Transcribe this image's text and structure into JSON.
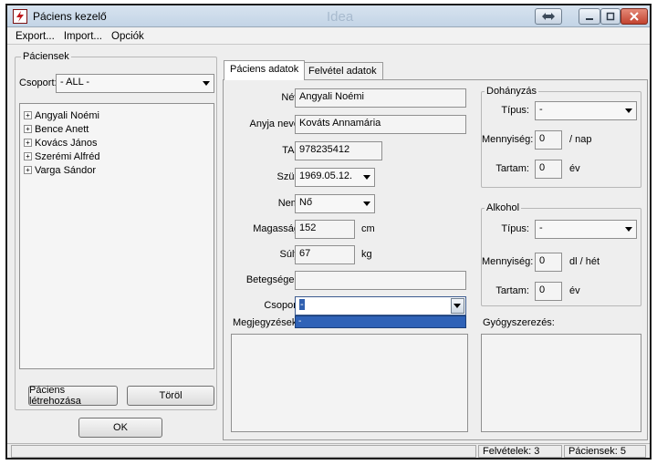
{
  "window": {
    "title": "Páciens kezelő",
    "watermark": "Idea"
  },
  "menu": [
    "Export...",
    "Import...",
    "Opciók"
  ],
  "left": {
    "group_title": "Páciensek",
    "group_filter_label": "Csoport:",
    "group_filter_value": "- ALL -",
    "patients": [
      "Angyali Noémi",
      "Bence Anett",
      "Kovács János",
      "Szerémi Alfréd",
      "Varga Sándor"
    ],
    "create_button": "Páciens létrehozása",
    "delete_button": "Töröl",
    "ok_button": "OK"
  },
  "tabs": [
    "Páciens adatok",
    "Felvétel adatok"
  ],
  "form": {
    "name_label": "Név:",
    "name_value": "Angyali Noémi",
    "mother_label": "Anyja neve:",
    "mother_value": "Kováts Annamária",
    "taj_label": "TAJ:",
    "taj_value": "978235412",
    "birth_label": "Szül.:",
    "birth_value": "1969.05.12.",
    "sex_label": "Nem:",
    "sex_value": "Nő",
    "height_label": "Magasság:",
    "height_value": "152",
    "height_unit": "cm",
    "weight_label": "Súly:",
    "weight_value": "67",
    "weight_unit": "kg",
    "disease_label": "Betegségek:",
    "disease_value": "",
    "group_label": "Csoport:",
    "group_value": "-",
    "group_dropdown_option": "-",
    "notes_label": "Megjegyzések:"
  },
  "smoking": {
    "title": "Dohányzás",
    "type_label": "Típus:",
    "type_value": "-",
    "amount_label": "Mennyiség:",
    "amount_value": "0",
    "amount_unit": "/ nap",
    "duration_label": "Tartam:",
    "duration_value": "0",
    "duration_unit": "év"
  },
  "alcohol": {
    "title": "Alkohol",
    "type_label": "Típus:",
    "type_value": "-",
    "amount_label": "Mennyiség:",
    "amount_value": "0",
    "amount_unit": "dl / hét",
    "duration_label": "Tartam:",
    "duration_value": "0",
    "duration_unit": "év"
  },
  "medication_label": "Gyógyszerezés:",
  "status": {
    "admissions": "Felvételek: 3",
    "patients": "Páciensek: 5"
  }
}
